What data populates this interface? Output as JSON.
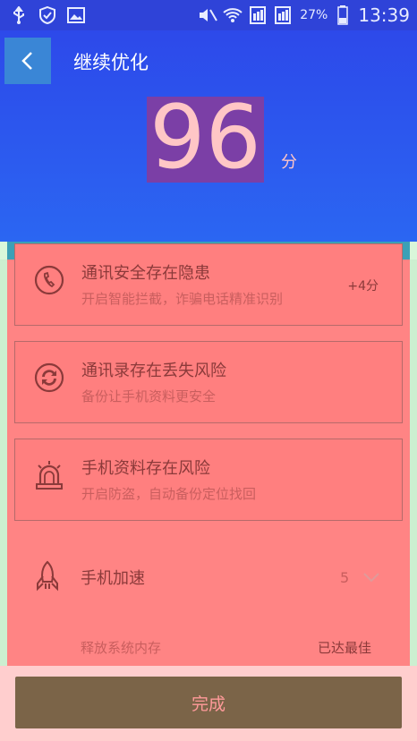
{
  "statusbar": {
    "icons_left": [
      "usb-icon",
      "shield-check-icon",
      "image-icon"
    ],
    "icons_right": [
      "mute-icon",
      "wifi-icon",
      "sim1-icon",
      "sim2-icon",
      "battery-icon"
    ],
    "battery_percent": "27%",
    "time": "13:39"
  },
  "header": {
    "title": "继续优化",
    "score": "96",
    "score_unit": "分"
  },
  "items": [
    {
      "icon": "call-security-icon",
      "title": "通讯安全存在隐患",
      "subtitle": "开启智能拦截，诈骗电话精准识别",
      "badge": "+4分"
    },
    {
      "icon": "sync-icon",
      "title": "通讯录存在丢失风险",
      "subtitle": "备份让手机资料更安全",
      "badge": ""
    },
    {
      "icon": "alarm-light-icon",
      "title": "手机资料存在风险",
      "subtitle": "开启防盗，自动备份定位找回",
      "badge": ""
    }
  ],
  "speedup": {
    "icon": "rocket-icon",
    "title": "手机加速",
    "count": "5",
    "memory_label": "释放系统内存",
    "memory_status": "已达最佳"
  },
  "footer": {
    "done_label": "完成"
  },
  "colors": {
    "header_top": "#2d49ea",
    "header_bottom": "#2b66f2",
    "card_bg": "#ff7f7f",
    "button_bg": "#7b6448"
  }
}
